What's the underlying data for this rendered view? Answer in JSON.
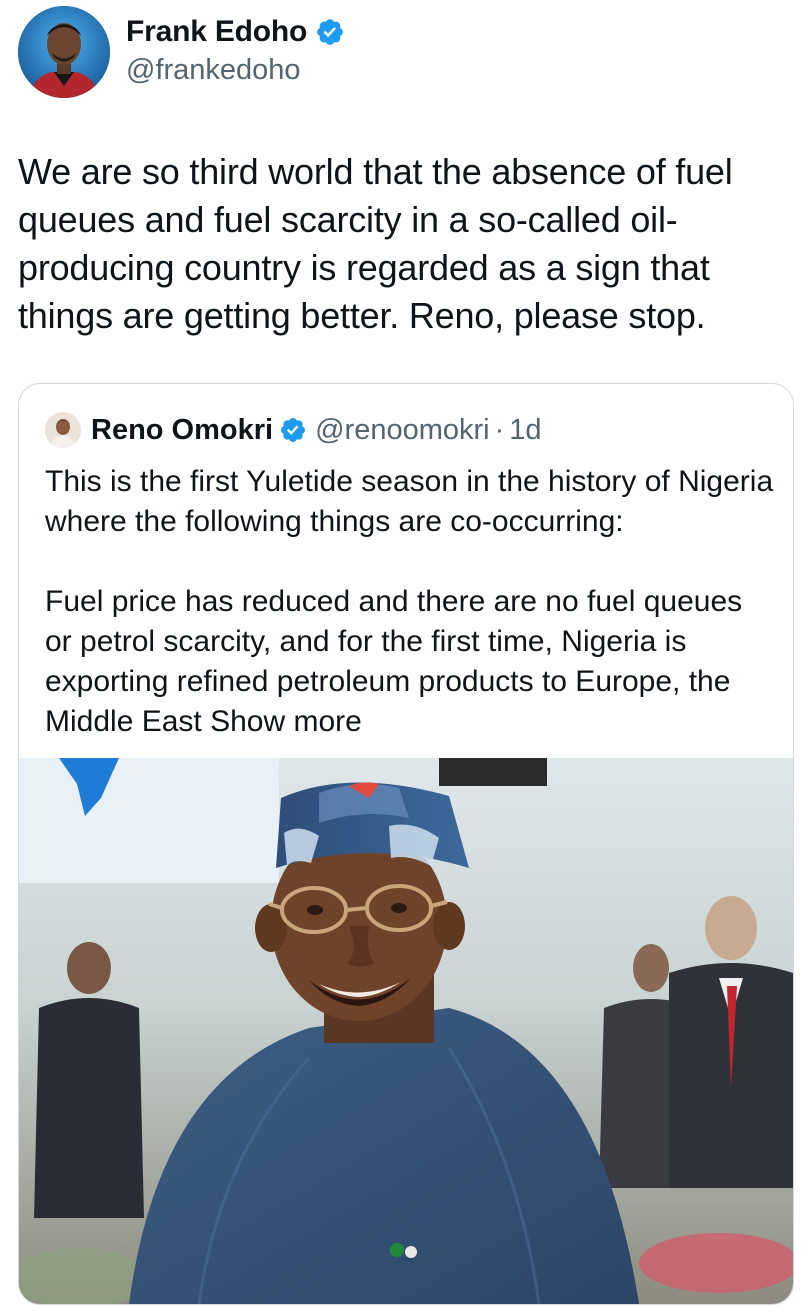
{
  "tweet": {
    "author": {
      "name": "Frank Edoho",
      "handle": "@frankedoho",
      "verified_icon": "verified-badge-icon"
    },
    "text": "We are so third world that the absence of fuel queues and fuel scarcity in a so-called oil-producing country is regarded as a sign that things are getting better. Reno, please stop."
  },
  "quoted_tweet": {
    "author": {
      "name": "Reno Omokri",
      "handle": "@renoomokri",
      "separator": "·",
      "time": "1d",
      "verified_icon": "verified-badge-icon"
    },
    "paragraph_1": "This is the first Yuletide season in the history of Nigeria where the following things are co-occurring:",
    "paragraph_2": "Fuel price has reduced and there are no fuel queues or petrol scarcity, and for the first time, Nigeria is exporting refined petroleum products to Europe, the Middle East",
    "show_more": "Show more"
  },
  "colors": {
    "text_primary": "#0f1419",
    "text_secondary": "#536471",
    "verified_blue": "#1d9bf0",
    "card_border": "#cfd9de"
  }
}
